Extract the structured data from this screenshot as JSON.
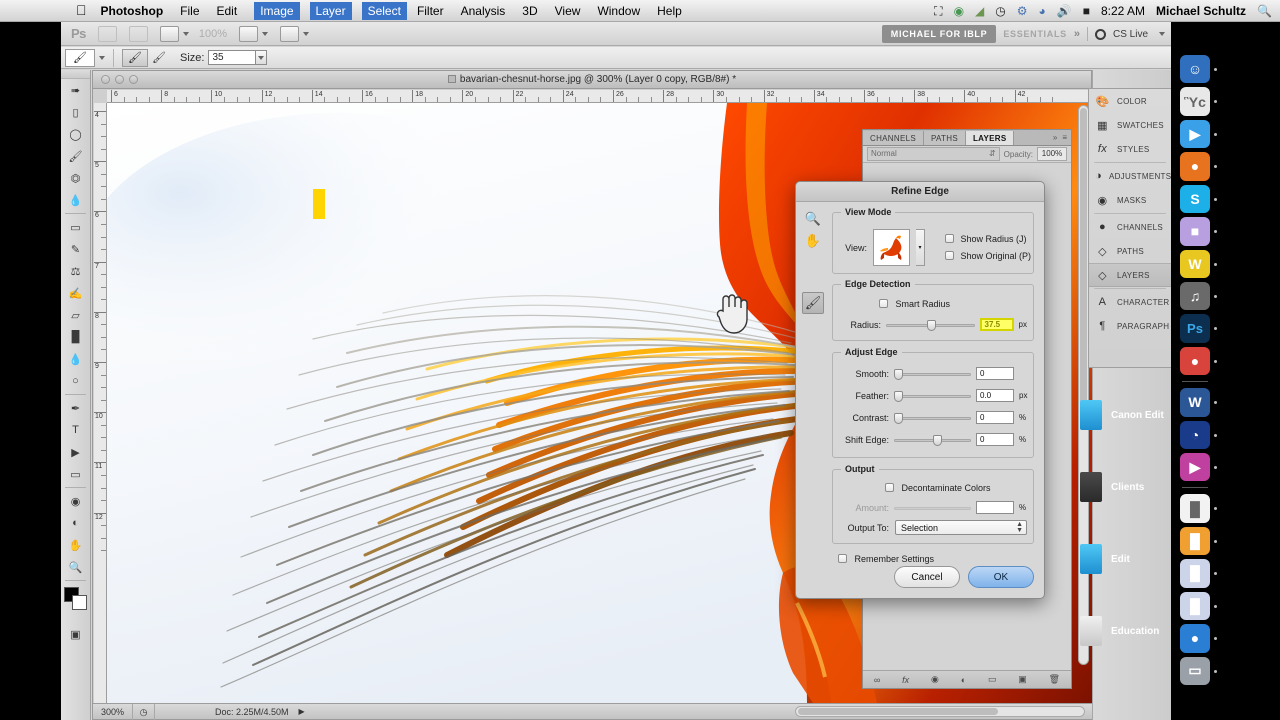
{
  "menubar": {
    "apple": "apple-logo",
    "items": [
      {
        "label": "Photoshop",
        "bold": true
      },
      {
        "label": "File",
        "bold": false
      },
      {
        "label": "Edit",
        "bold": false
      },
      {
        "label": "Image",
        "bold": false
      },
      {
        "label": "Layer",
        "bold": false
      },
      {
        "label": "Select",
        "bold": false
      },
      {
        "label": "Filter",
        "bold": false
      },
      {
        "label": "Analysis",
        "bold": false
      },
      {
        "label": "3D",
        "bold": false
      },
      {
        "label": "View",
        "bold": false
      },
      {
        "label": "Window",
        "bold": false
      },
      {
        "label": "Help",
        "bold": false
      }
    ],
    "status_icons": [
      "screen-recorder-icon",
      "globe-icon",
      "evernote-icon",
      "clock-icon",
      "bluetooth-icon",
      "wifi-icon",
      "volume-icon",
      "battery-icon"
    ],
    "time": "8:22 AM",
    "user": "Michael Schultz",
    "search_icon": "spotlight-search-icon"
  },
  "optionsbar": {
    "ps_logo": "Ps",
    "zoom_value": "100%",
    "workspace_button": "MICHAEL FOR IBLP",
    "workspace_essentials": "ESSENTIALS",
    "workspace_chevron": "»",
    "cs_live": "CS Live",
    "tool_preset_icon": "refine-radius-brush-icon",
    "brush_mode_a": "refine-radius-tool-icon",
    "brush_mode_b": "erase-refinements-tool-icon",
    "size_label": "Size:",
    "size_value": "35"
  },
  "toolbox": {
    "tools": [
      "move-tool",
      "marquee-tool",
      "lasso-tool",
      "quick-selection-tool",
      "crop-tool",
      "eyedropper-tool",
      "spot-healing-tool",
      "brush-tool",
      "clone-stamp-tool",
      "history-brush-tool",
      "eraser-tool",
      "gradient-tool",
      "blur-tool",
      "dodge-tool",
      "pen-tool",
      "type-tool",
      "path-selection-tool",
      "shape-tool",
      "3d-rotate-tool",
      "3d-orbit-tool",
      "hand-tool",
      "zoom-tool"
    ],
    "foreground_color": "#000000",
    "background_color": "#ffffff"
  },
  "document": {
    "title": "bavarian-chesnut-horse.jpg @ 300% (Layer 0 copy, RGB/8#) *",
    "ruler_h_ticks": [
      6,
      8,
      10,
      12,
      14,
      16,
      18,
      20,
      22,
      24,
      26,
      28,
      30,
      32,
      34,
      36,
      38,
      40,
      42
    ],
    "ruler_v_ticks": [
      4,
      5,
      6,
      7,
      8,
      9,
      10,
      11,
      12
    ],
    "status_zoom": "300%",
    "status_doc": "Doc: 2.25M/4.50M",
    "status_arrow": "▶",
    "cursor_icon": "hand-cursor"
  },
  "panel_dock": {
    "items": [
      {
        "label": "COLOR",
        "icon": "color-palette-icon",
        "active": false
      },
      {
        "label": "SWATCHES",
        "icon": "swatches-grid-icon",
        "active": false
      },
      {
        "label": "STYLES",
        "icon": "styles-fx-icon",
        "active": false
      },
      {
        "sep": true
      },
      {
        "label": "ADJUSTMENTS",
        "icon": "adjustments-circle-icon",
        "active": false
      },
      {
        "label": "MASKS",
        "icon": "masks-icon",
        "active": false
      },
      {
        "sep": true
      },
      {
        "label": "CHANNELS",
        "icon": "channels-sphere-icon",
        "active": false
      },
      {
        "label": "PATHS",
        "icon": "paths-icon",
        "active": false
      },
      {
        "label": "LAYERS",
        "icon": "layers-stack-icon",
        "active": true
      },
      {
        "sep": true
      },
      {
        "label": "CHARACTER",
        "icon": "character-a-icon",
        "active": false
      },
      {
        "label": "PARAGRAPH",
        "icon": "paragraph-pilcrow-icon",
        "active": false
      }
    ]
  },
  "layers_panel": {
    "tabs": [
      {
        "label": "CHANNELS",
        "active": false
      },
      {
        "label": "PATHS",
        "active": false
      },
      {
        "label": "LAYERS",
        "active": true
      }
    ],
    "collapse_icon": "»",
    "menu_icon": "≡",
    "blend_mode": "Normal",
    "opacity_label": "Opacity:",
    "opacity_value": "100%",
    "bottom_icons": [
      "link-layers-icon",
      "add-style-fx-icon",
      "add-mask-icon",
      "adjustment-layer-icon",
      "new-group-icon",
      "new-layer-icon",
      "delete-layer-icon"
    ]
  },
  "refine_edge": {
    "title": "Refine Edge",
    "tools": [
      "zoom-tool-icon",
      "hand-tool-icon",
      "refine-radius-brush-icon"
    ],
    "view_mode": {
      "legend": "View Mode",
      "view_label": "View:",
      "thumbnail": "horse-on-layers-preview",
      "show_radius": {
        "label": "Show Radius (J)",
        "checked": false
      },
      "show_original": {
        "label": "Show Original (P)",
        "checked": false
      }
    },
    "edge_detection": {
      "legend": "Edge Detection",
      "smart_radius": {
        "label": "Smart Radius",
        "checked": false
      },
      "radius_label": "Radius:",
      "radius_value": "37.5",
      "radius_unit": "px",
      "radius_pct": 46,
      "highlight_color": "#ffff66"
    },
    "adjust_edge": {
      "legend": "Adjust Edge",
      "rows": [
        {
          "label": "Smooth:",
          "value": "0",
          "unit": "",
          "pct": 0
        },
        {
          "label": "Feather:",
          "value": "0.0",
          "unit": "px",
          "pct": 0
        },
        {
          "label": "Contrast:",
          "value": "0",
          "unit": "%",
          "pct": 0
        },
        {
          "label": "Shift Edge:",
          "value": "0",
          "unit": "%",
          "pct": 50
        }
      ]
    },
    "output": {
      "legend": "Output",
      "decontaminate": {
        "label": "Decontaminate Colors",
        "checked": false
      },
      "amount_label": "Amount:",
      "amount_value": "",
      "amount_unit": "%",
      "output_to_label": "Output To:",
      "output_to_value": "Selection"
    },
    "remember_settings": {
      "label": "Remember Settings",
      "checked": false
    },
    "cancel_button": "Cancel",
    "ok_button": "OK"
  },
  "desktop": {
    "folders": [
      {
        "label": "Canon Edit",
        "color": "#3fb7e8"
      },
      {
        "label": "Clients",
        "color": "#3a3a3a"
      },
      {
        "label": "Edit",
        "color": "#3fb7e8"
      },
      {
        "label": "Education",
        "color": "#d8d8d8"
      }
    ],
    "dock_icons": [
      {
        "name": "finder-icon",
        "glyph": "☺",
        "bg": "#2f6fbe"
      },
      {
        "name": "preview-icon",
        "glyph": "Ὓc",
        "bg": "#e8e8e8"
      },
      {
        "name": "facetime-icon",
        "glyph": "▶",
        "bg": "#3aa0e8"
      },
      {
        "name": "firefox-icon",
        "glyph": "●",
        "bg": "#e8731f"
      },
      {
        "name": "skype-icon",
        "glyph": "S",
        "bg": "#1db0e8"
      },
      {
        "name": "delivery-icon",
        "glyph": "■",
        "bg": "#b8a0e0"
      },
      {
        "name": "audio-app-icon",
        "glyph": "W",
        "bg": "#e8c820"
      },
      {
        "name": "dj-app-icon",
        "glyph": "♫",
        "bg": "#6a6a6a"
      },
      {
        "name": "photoshop-icon",
        "glyph": "Ps",
        "bg": "#0d2f4f"
      },
      {
        "name": "chrome-icon",
        "glyph": "●",
        "bg": "#d8443c"
      },
      {
        "name": "word-icon",
        "glyph": "W",
        "bg": "#2b5797"
      },
      {
        "name": "headphones-icon",
        "glyph": "◔",
        "bg": "#1a3a8a"
      },
      {
        "name": "imovie-icon",
        "glyph": "▶",
        "bg": "#c040a0"
      },
      {
        "name": "document-icon",
        "glyph": "█",
        "bg": "#f2f2f2"
      },
      {
        "name": "archive-icon",
        "glyph": "█",
        "bg": "#f0a030"
      },
      {
        "name": "card-1-icon",
        "glyph": "█",
        "bg": "#ccd4ea"
      },
      {
        "name": "card-2-icon",
        "glyph": "█",
        "bg": "#ccd4ea"
      },
      {
        "name": "globe-icon",
        "glyph": "●",
        "bg": "#2a7fd4"
      },
      {
        "name": "trash-icon",
        "glyph": "▭",
        "bg": "#9aa0a8"
      }
    ]
  }
}
